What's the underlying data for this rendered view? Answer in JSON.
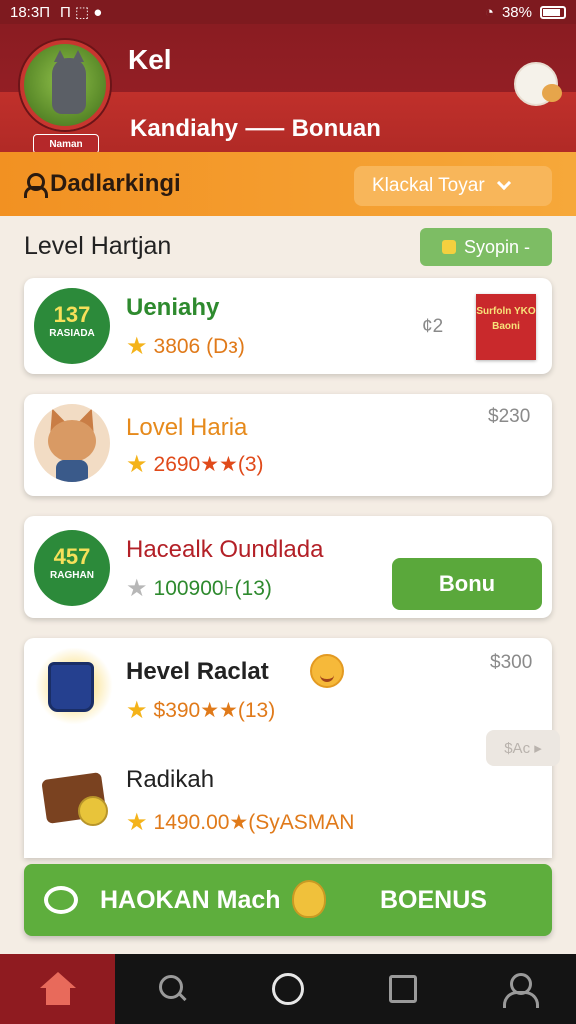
{
  "status_bar": {
    "time": "18:3П",
    "left_icons": "П ⬚ ●",
    "battery": "38%"
  },
  "header": {
    "user_name": "Kel",
    "subtitle": "Kandiahy ⸺ Bonuan",
    "avatar_badge": "Naman"
  },
  "orange_bar": {
    "title": "Dadlarkingi",
    "dropdown_value": "Klackal Toyar"
  },
  "section": {
    "title": "Level Hartjan",
    "sync_label": "Syopin -"
  },
  "cards": [
    {
      "badge_number": "137",
      "badge_label": "RASIADA",
      "title": "Ueniahy",
      "rating": "3806 (Dз)",
      "corner": "¢2",
      "tag": "Surfoln YKO Baoni",
      "colors": {
        "title": "#2e8a2e",
        "rating": "#e07a1a"
      }
    },
    {
      "title": "Lovel Haria",
      "rating": "2690★★(3)",
      "corner": "$230",
      "colors": {
        "title": "#e68a1c",
        "rating": "#e04a1a"
      }
    },
    {
      "badge_number": "457",
      "badge_label": "RAGHAN",
      "title": "Hacealk Oundlada",
      "rating": "100900⊦(13)",
      "button_label": "Bonu",
      "colors": {
        "title": "#b32027",
        "rating": "#2e8a2e"
      }
    },
    {
      "title": "Hevel Raclat",
      "rating": "$390★★(13)",
      "corner": "$300",
      "pill": "$Ac ▸",
      "title2": "Radikah",
      "rating2": "1490.00★(SyASMAN",
      "colors": {
        "title": "#222222",
        "rating": "#e07a1a"
      }
    }
  ],
  "bonus_bar": {
    "left_label": "HAOKAN Mach",
    "right_label": "BOENUS"
  },
  "navbar": {
    "items": [
      "home",
      "search",
      "circle",
      "square",
      "profile"
    ]
  }
}
